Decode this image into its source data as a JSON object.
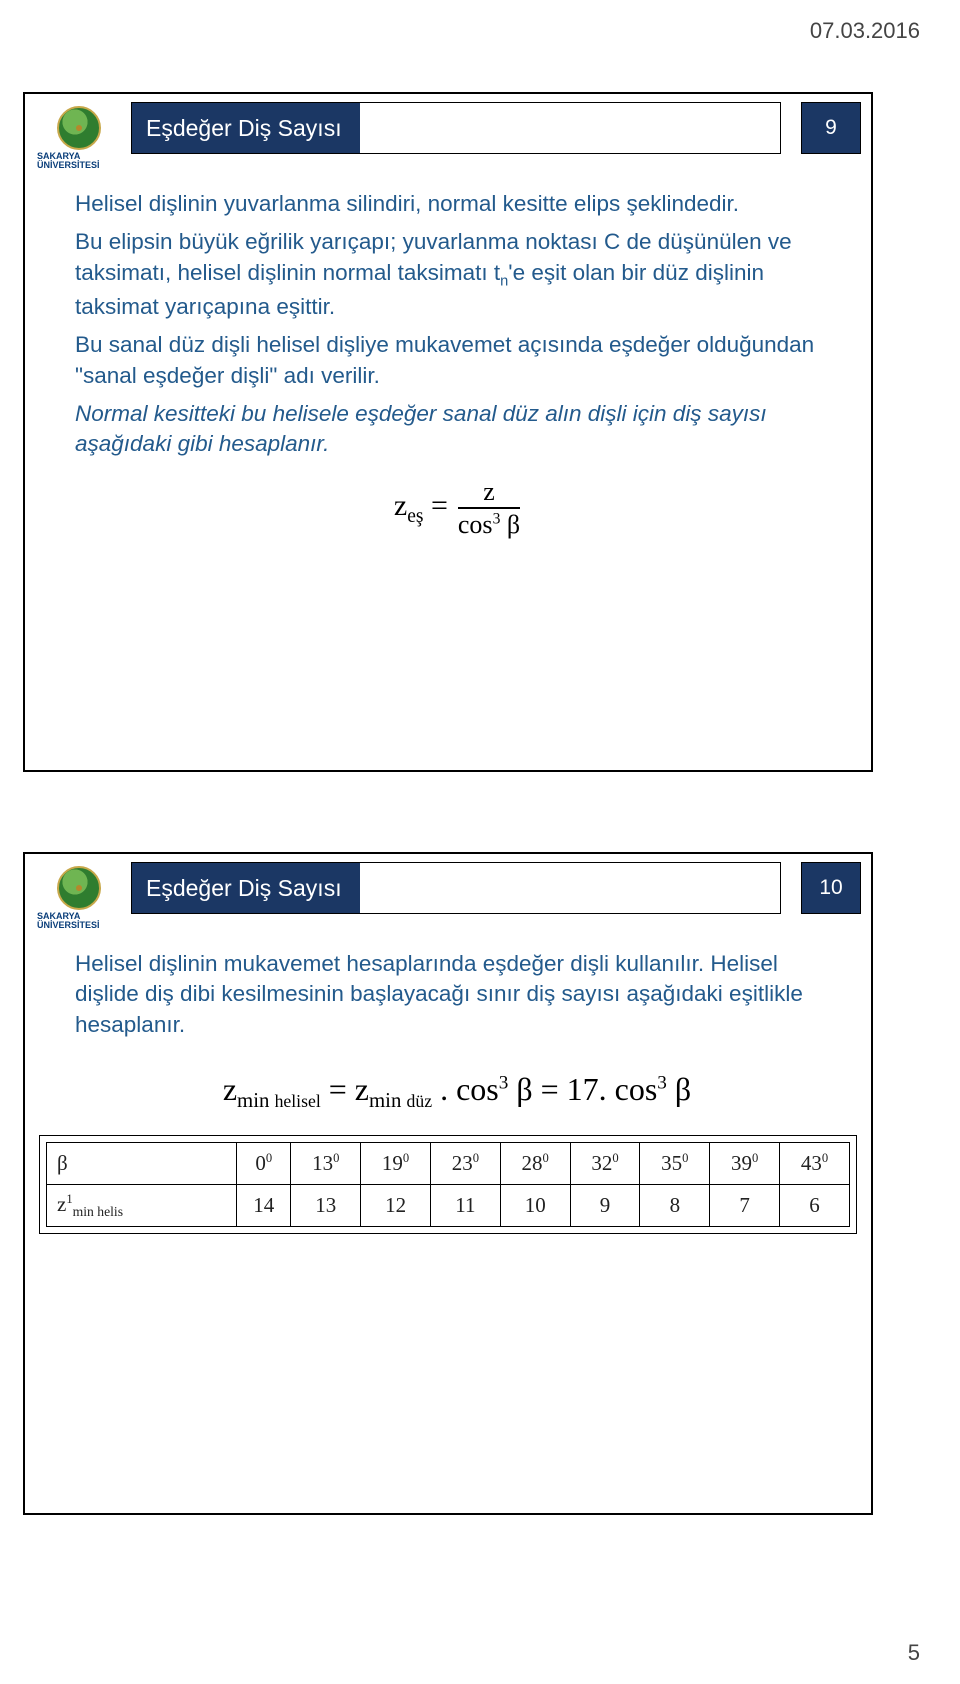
{
  "page": {
    "date": "07.03.2016",
    "number": "5"
  },
  "logo": {
    "line1": "SAKARYA",
    "line2": "ÜNİVERSİTESİ"
  },
  "slide9": {
    "title": "Eşdeğer Diş Sayısı",
    "num": "9",
    "p1": "Helisel dişlinin yuvarlanma silindiri, normal kesitte elips şeklindedir.",
    "p2_a": "Bu elipsin büyük eğrilik yarıçapı; yuvarlanma noktası C de düşünülen ve taksimatı, helisel dişlinin normal taksimatı t",
    "p2_sub": "n",
    "p2_b": "'e eşit olan bir düz dişlinin taksimat yarıçapına eşittir.",
    "p3": "Bu sanal düz dişli helisel dişliye mukavemet açısında eşdeğer olduğundan \"sanal eşdeğer dişli\" adı verilir.",
    "p4": "Normal kesitteki bu helisele eşdeğer sanal düz alın dişli için diş sayısı aşağıdaki gibi hesaplanır.",
    "formula": {
      "lhs_main": "z",
      "lhs_sub": "eş",
      "eq": " = ",
      "num_main": "z",
      "den_prefix": "cos",
      "den_sup": "3",
      "den_suffix": " β"
    }
  },
  "slide10": {
    "title": "Eşdeğer Diş Sayısı",
    "num": "10",
    "p1": "Helisel dişlinin mukavemet hesaplarında eşdeğer dişli kullanılır. Helisel dişlide diş dibi kesilmesinin başlayacağı sınır diş sayısı aşağıdaki eşitlikle hesaplanır.",
    "formula": "z",
    "formula_sub1": "min",
    "formula_sub1b": "helisel",
    "formula_eq1": " = z",
    "formula_sub2": "min",
    "formula_sub2b": "düz",
    "formula_mid": ". cos",
    "formula_sup1": "3",
    "formula_beta": " β = 17. cos",
    "formula_sup2": "3",
    "formula_end": " β",
    "table": {
      "row1_label": "β",
      "row1": [
        "0",
        "13",
        "19",
        "23",
        "28",
        "32",
        "35",
        "39",
        "43"
      ],
      "row2_label_a": "z",
      "row2_label_sup": "1",
      "row2_label_sub": "min helis",
      "row2": [
        "14",
        "13",
        "12",
        "11",
        "10",
        "9",
        "8",
        "7",
        "6"
      ]
    }
  },
  "chart_data": {
    "type": "table",
    "title": "Minimum tooth count vs helix angle β",
    "categories_deg": [
      0,
      13,
      19,
      23,
      28,
      32,
      35,
      39,
      43
    ],
    "values_z_min_helis": [
      14,
      13,
      12,
      11,
      10,
      9,
      8,
      7,
      6
    ]
  }
}
